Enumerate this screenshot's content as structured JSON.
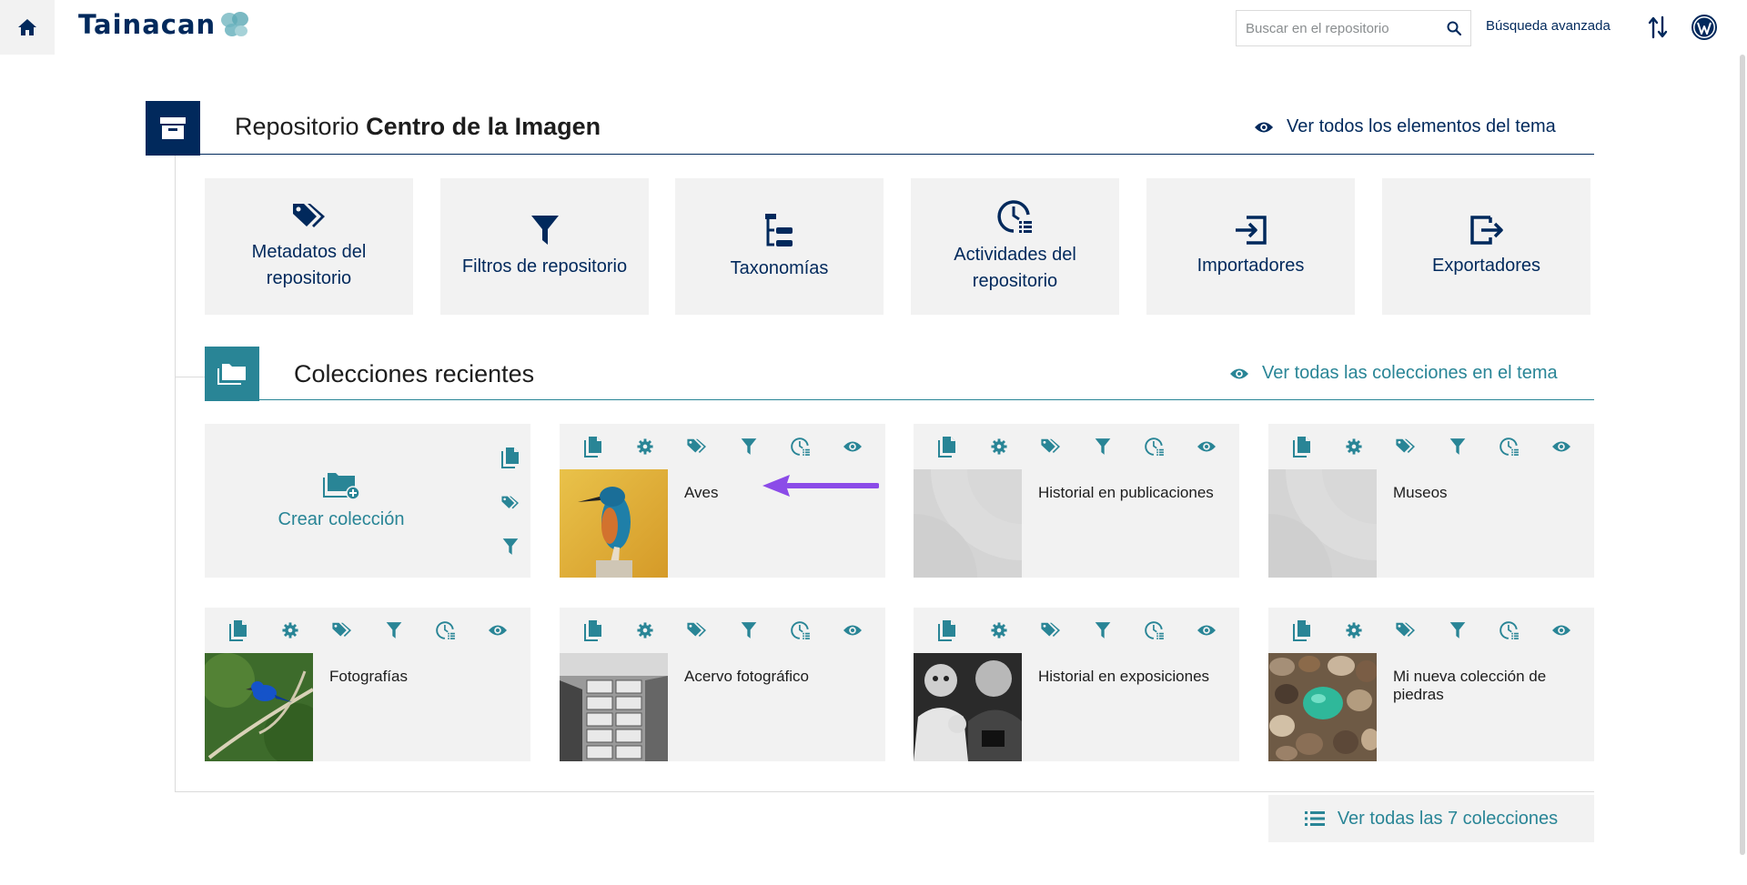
{
  "header": {
    "logo_text": "Tainacan",
    "search_placeholder": "Buscar en el repositorio",
    "advanced_search": "Búsqueda avanzada"
  },
  "repository": {
    "title_prefix": "Repositorio",
    "title_name": "Centro de la Imagen",
    "view_all": "Ver todos los elementos del tema",
    "tiles": [
      {
        "label": "Metadatos del repositorio",
        "icon": "tags-icon"
      },
      {
        "label": "Filtros de repositorio",
        "icon": "filter-icon"
      },
      {
        "label": "Taxonomías",
        "icon": "taxonomy-icon"
      },
      {
        "label": "Actividades del repositorio",
        "icon": "activities-icon"
      },
      {
        "label": "Importadores",
        "icon": "importer-icon"
      },
      {
        "label": "Exportadores",
        "icon": "exporter-icon"
      }
    ]
  },
  "collections": {
    "title": "Colecciones recientes",
    "view_all_theme": "Ver todas las colecciones en el tema",
    "create_label": "Crear colección",
    "items": [
      {
        "name": "Aves",
        "thumb": "kingfisher-photo"
      },
      {
        "name": "Historial en publicaciones",
        "thumb": "placeholder"
      },
      {
        "name": "Museos",
        "thumb": "placeholder"
      },
      {
        "name": "Fotografías",
        "thumb": "blue-bird-photo"
      },
      {
        "name": "Acervo fotográfico",
        "thumb": "archive-drawers-photo"
      },
      {
        "name": "Historial en exposiciones",
        "thumb": "bw-people-photo"
      },
      {
        "name": "Mi nueva colección de piedras",
        "thumb": "stones-photo"
      }
    ],
    "view_all_count": "Ver todas las 7 colecciones"
  },
  "colors": {
    "navy": "#01295c",
    "teal": "#298596",
    "tile_bg": "#f2f2f2",
    "annotation_arrow": "#8b4be8"
  }
}
